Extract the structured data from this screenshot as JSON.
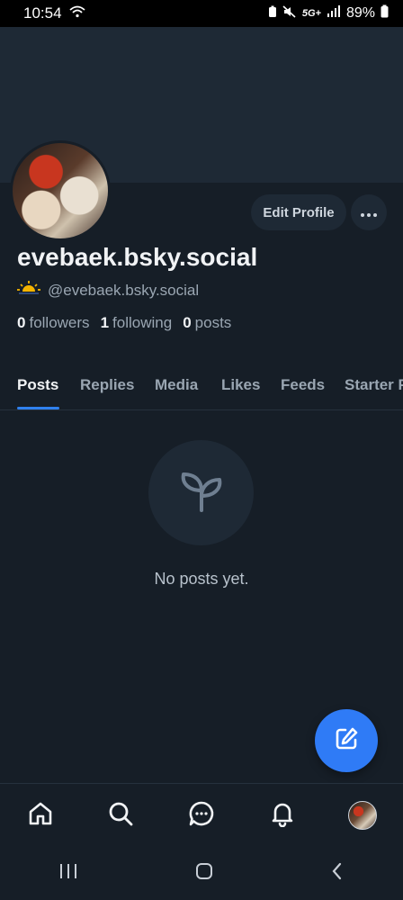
{
  "status_bar": {
    "time": "10:54",
    "network": "5G+",
    "battery": "89%"
  },
  "profile": {
    "display_name": "evebaek.bsky.social",
    "handle": "@evebaek.bsky.social",
    "edit_button": "Edit Profile",
    "stats": {
      "followers_count": "0",
      "followers_label": "followers",
      "following_count": "1",
      "following_label": "following",
      "posts_count": "0",
      "posts_label": "posts"
    }
  },
  "tabs": [
    {
      "label": "Posts",
      "active": true
    },
    {
      "label": "Replies",
      "active": false
    },
    {
      "label": "Media",
      "active": false
    },
    {
      "label": "Likes",
      "active": false
    },
    {
      "label": "Feeds",
      "active": false
    },
    {
      "label": "Starter Packs",
      "active": false
    }
  ],
  "empty_state": {
    "icon": "seedling-icon",
    "text": "No posts yet."
  },
  "bottom_nav": [
    "home-icon",
    "search-icon",
    "messages-icon",
    "notifications-icon",
    "profile-avatar"
  ],
  "colors": {
    "background": "#161e27",
    "banner": "#1e2935",
    "accent": "#2f7bf6",
    "muted_text": "#9aa6b2"
  }
}
